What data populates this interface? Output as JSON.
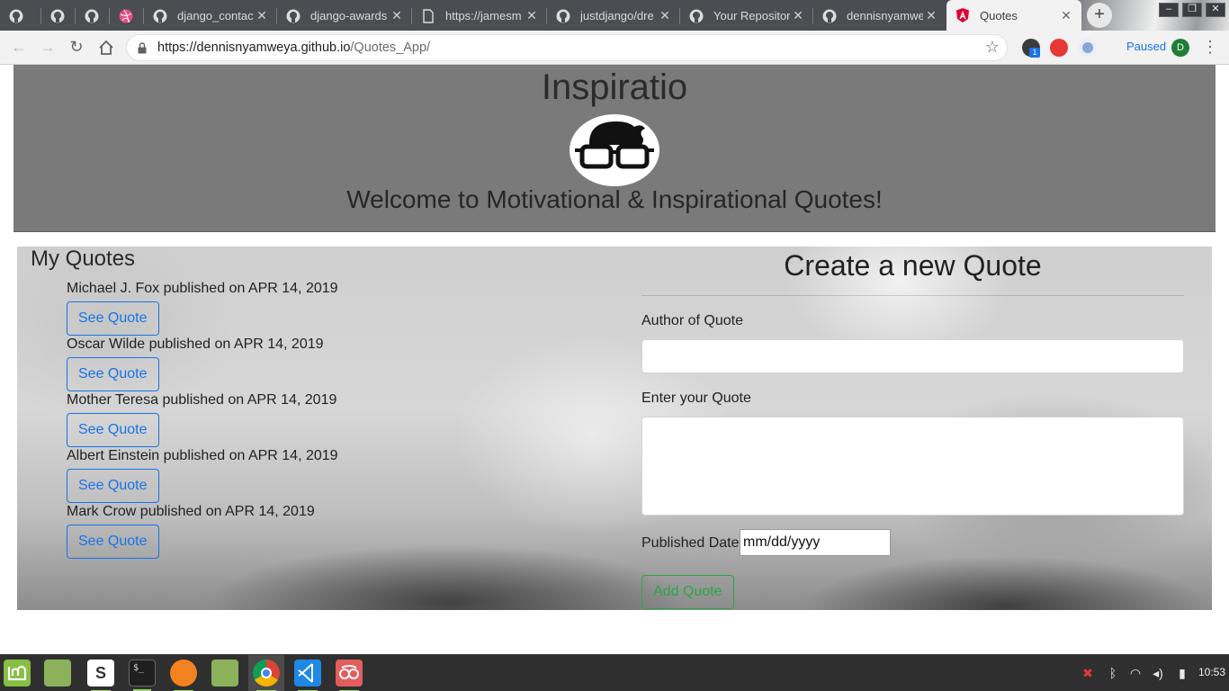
{
  "browser": {
    "tabs": [
      {
        "title": "",
        "icon": "github-icon"
      },
      {
        "title": "",
        "icon": "github-icon"
      },
      {
        "title": "",
        "icon": "github-icon"
      },
      {
        "title": "",
        "icon": "dribbble-icon"
      },
      {
        "title": "django_contact",
        "icon": "github-icon"
      },
      {
        "title": "django-awards",
        "icon": "github-icon"
      },
      {
        "title": "https://jamesm",
        "icon": "page-icon"
      },
      {
        "title": "justdjango/dre",
        "icon": "github-icon"
      },
      {
        "title": "Your Repositori",
        "icon": "github-icon"
      },
      {
        "title": "dennisnyamwe",
        "icon": "github-icon"
      },
      {
        "title": "Quotes",
        "icon": "angular-icon",
        "active": true
      }
    ],
    "url_host": "https://dennisnyamweya.github.io",
    "url_path": "/Quotes_App/",
    "sync_status": "Paused",
    "profile_initial": "D",
    "extension_badge": "1"
  },
  "page": {
    "site_title": "Inspiratio",
    "welcome": "Welcome to Motivational & Inspirational Quotes!",
    "my_quotes_title": "My Quotes",
    "published_label": "published on",
    "see_quote_label": "See Quote",
    "quotes": [
      {
        "author": "Michael J. Fox",
        "date": "APR 14, 2019"
      },
      {
        "author": "Oscar Wilde",
        "date": "APR 14, 2019"
      },
      {
        "author": "Mother Teresa",
        "date": "APR 14, 2019"
      },
      {
        "author": "Albert Einstein",
        "date": "APR 14, 2019"
      },
      {
        "author": "Mark Crow",
        "date": "APR 14, 2019"
      }
    ],
    "form": {
      "title": "Create a new Quote",
      "author_label": "Author of Quote",
      "author_value": "",
      "quote_label": "Enter your Quote",
      "quote_value": "",
      "date_label": "Published Date",
      "date_placeholder": "mm/dd/yyyy",
      "submit_label": "Add Quote"
    }
  },
  "taskbar": {
    "clock": "10:53"
  },
  "colors": {
    "link_blue": "#1a73e8",
    "success_green": "#28a745",
    "banner_gray": "#7a7a7a"
  }
}
